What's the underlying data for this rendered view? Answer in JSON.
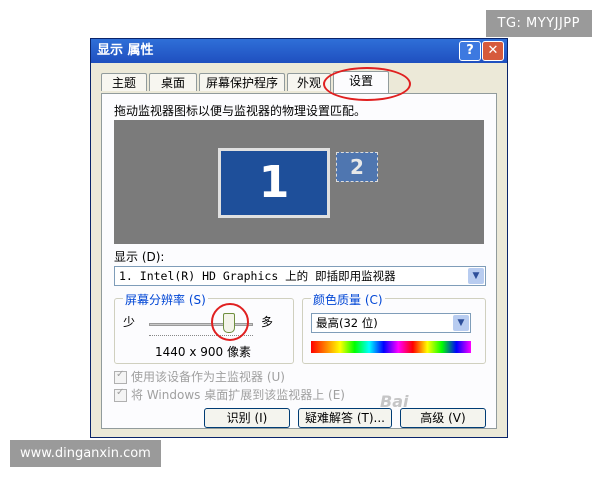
{
  "overlay": {
    "top_right": "TG: MYYJJPP",
    "bottom_left": "www.dinganxin.com",
    "baidu": "Bai"
  },
  "window": {
    "title": "显示 属性",
    "help_button": "?",
    "close_button": "✕"
  },
  "tabs": [
    {
      "label": "主题"
    },
    {
      "label": "桌面"
    },
    {
      "label": "屏幕保护程序"
    },
    {
      "label": "外观"
    },
    {
      "label": "设置",
      "active": true
    }
  ],
  "settings": {
    "instruction": "拖动监视器图标以便与监视器的物理设置匹配。",
    "monitor_1": "1",
    "monitor_2": "2",
    "display_label": "显示 (D):",
    "display_value": "1. Intel(R) HD Graphics 上的 即插即用监视器",
    "resolution": {
      "title": "屏幕分辨率 (S)",
      "min_label": "少",
      "max_label": "多",
      "value": "1440 x 900 像素",
      "slider_fraction": 0.85
    },
    "color_quality": {
      "title": "颜色质量 (C)",
      "value": "最高(32 位)"
    },
    "checkbox_primary": "使用该设备作为主监视器 (U)",
    "checkbox_extend": "将 Windows 桌面扩展到该监视器上 (E)",
    "buttons": {
      "identify": "识别 (I)",
      "troubleshoot": "疑难解答 (T)...",
      "advanced": "高级 (V)"
    }
  }
}
